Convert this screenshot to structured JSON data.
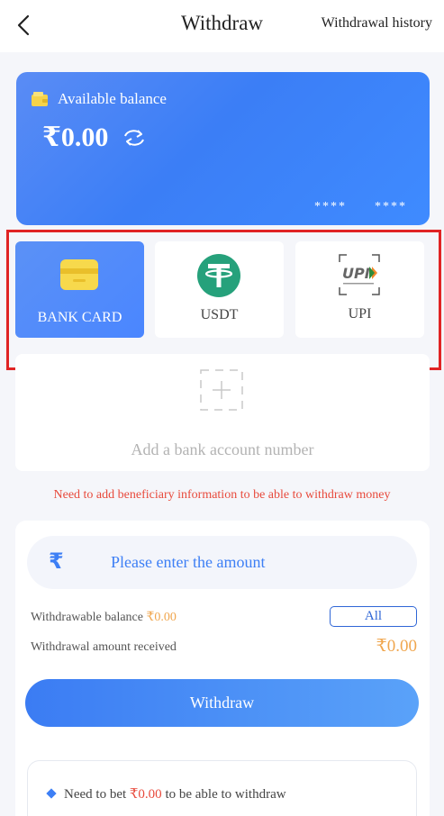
{
  "header": {
    "title": "Withdraw",
    "history_label": "Withdrawal history"
  },
  "balance": {
    "label": "Available balance",
    "amount": "₹0.00",
    "card_mask_1": "****",
    "card_mask_2": "****"
  },
  "methods": [
    {
      "label": "BANK CARD",
      "icon": "bank-card-icon",
      "active": true
    },
    {
      "label": "USDT",
      "icon": "usdt-icon",
      "active": false
    },
    {
      "label": "UPI",
      "icon": "upi-logo",
      "active": false
    }
  ],
  "add_account": {
    "label": "Add a bank account number"
  },
  "warning": "Need to add beneficiary information to be able to withdraw money",
  "form": {
    "currency_symbol": "₹",
    "placeholder": "Please enter the amount",
    "withdrawable_label": "Withdrawable balance ",
    "withdrawable_value": "₹0.00",
    "all_label": "All",
    "received_label": "Withdrawal amount received",
    "received_value": "₹0.00",
    "withdraw_label": "Withdraw",
    "notice_prefix": "Need to bet ",
    "notice_amount": "₹0.00",
    "notice_suffix": " to be able to withdraw"
  },
  "colors": {
    "accent": "#3d7ff5",
    "highlight": "#e02424",
    "warning": "#e84a3c",
    "amount": "#f0a64e",
    "usdt": "#26a17b"
  }
}
